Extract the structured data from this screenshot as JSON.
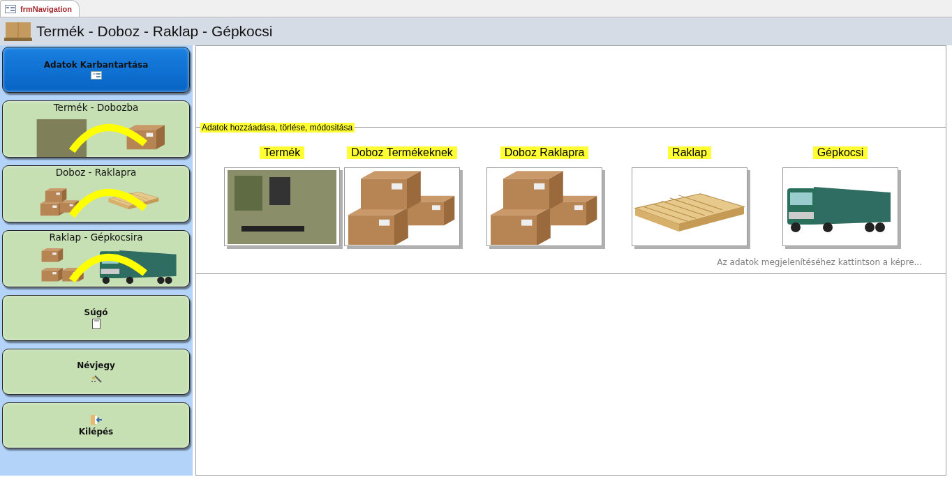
{
  "tab": {
    "title": "frmNavigation"
  },
  "header": {
    "title": "Termék - Doboz - Raklap - Gépkocsi"
  },
  "nav": [
    {
      "kind": "icon",
      "label": "Adatok Karbantartása",
      "selected": true
    },
    {
      "kind": "picture",
      "label": "Termék - Dobozba",
      "selected": false
    },
    {
      "kind": "picture",
      "label": "Doboz - Raklapra",
      "selected": false
    },
    {
      "kind": "picture",
      "label": "Raklap - Gépkocsira",
      "selected": false
    },
    {
      "kind": "icon",
      "label": "Súgó",
      "selected": false
    },
    {
      "kind": "icon",
      "label": "Névjegy",
      "selected": false
    },
    {
      "kind": "icon-top",
      "label": "Kilépés",
      "selected": false
    }
  ],
  "section": {
    "title": "Adatok hozzáadása, törlése, módositása",
    "items": [
      {
        "label": "Termék",
        "kind": "gear"
      },
      {
        "label": "Doboz Termékeknek",
        "kind": "boxes"
      },
      {
        "label": "Doboz Raklapra",
        "kind": "boxes"
      },
      {
        "label": "Raklap",
        "kind": "pallet"
      },
      {
        "label": "Gépkocsi",
        "kind": "truck"
      }
    ],
    "hint": "Az adatok megjelenítéséhez kattintson a képre..."
  }
}
